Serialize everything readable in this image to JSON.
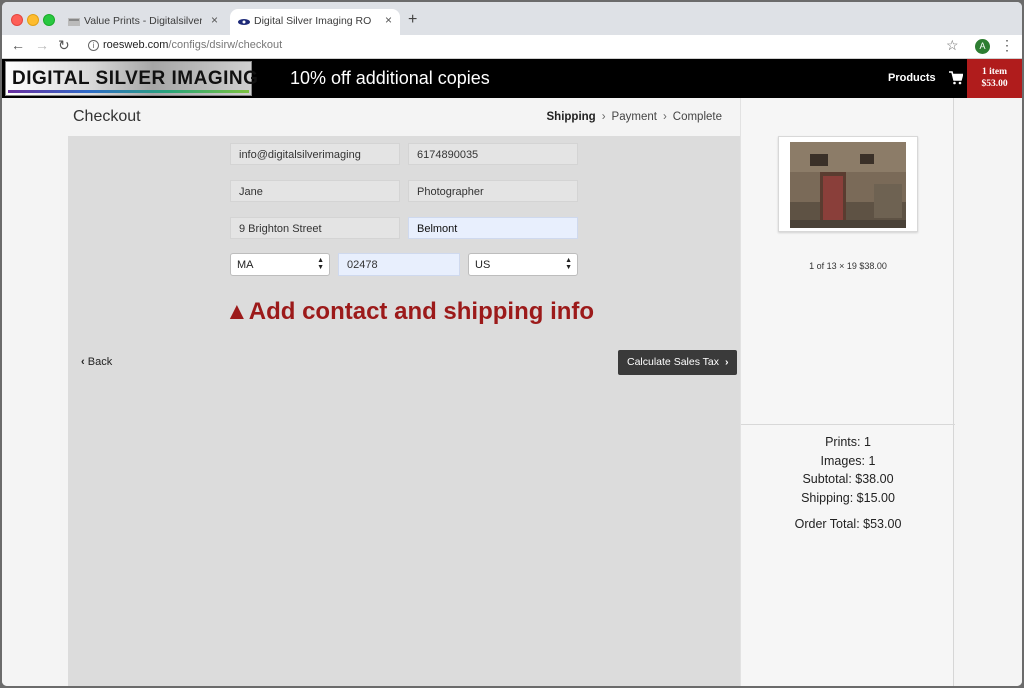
{
  "browser": {
    "tabs": [
      {
        "label": "Value Prints - Digitalsilverimag",
        "close": "×"
      },
      {
        "label": "Digital Silver Imaging ROES We",
        "close": "×"
      }
    ],
    "new_tab": "+",
    "url_host": "roesweb.com",
    "url_path": "/configs/dsirw/checkout",
    "avatar_letter": "A"
  },
  "header": {
    "logo_text": "DIGITAL SILVER IMAGING",
    "promo": "10% off additional copies",
    "products_label": "Products",
    "cart_count": "1 item",
    "cart_total": "$53.00"
  },
  "checkout": {
    "title": "Checkout",
    "steps": [
      "Shipping",
      "Payment",
      "Complete"
    ],
    "fields": {
      "email": "info@digitalsilverimaging",
      "phone": "6174890035",
      "first_name": "Jane",
      "last_name": "Photographer",
      "street": "9 Brighton Street",
      "city": "Belmont",
      "state": "MA",
      "zip": "02478",
      "country": "US"
    },
    "hint": "▲Add contact and shipping info",
    "back_label": "Back",
    "calc_label": "Calculate Sales Tax"
  },
  "sidebar": {
    "item_desc": "1 of 13 × 19 $38.00",
    "prints": "Prints: 1",
    "images": "Images: 1",
    "subtotal": "Subtotal: $38.00",
    "shipping": "Shipping: $15.00",
    "order_total": "Order Total: $53.00"
  },
  "colors": {
    "header_bg": "#000000",
    "cart_bg": "#b01c1c",
    "hint_text": "#9c1a1a",
    "button_bg": "#3a3a3a"
  }
}
